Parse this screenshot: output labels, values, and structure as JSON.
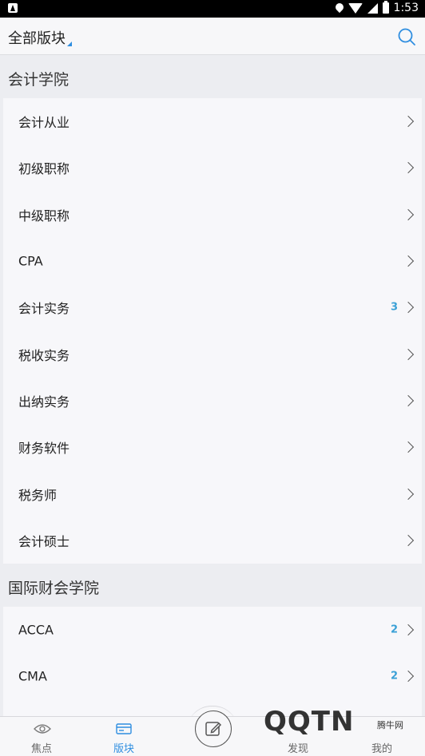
{
  "status_bar": {
    "time": "1:53"
  },
  "header": {
    "title": "全部版块"
  },
  "sections": [
    {
      "title": "会计学院",
      "items": [
        {
          "label": "会计从业",
          "badge": ""
        },
        {
          "label": "初级职称",
          "badge": ""
        },
        {
          "label": "中级职称",
          "badge": ""
        },
        {
          "label": "CPA",
          "badge": ""
        },
        {
          "label": "会计实务",
          "badge": "3"
        },
        {
          "label": "税收实务",
          "badge": ""
        },
        {
          "label": "出纳实务",
          "badge": ""
        },
        {
          "label": "财务软件",
          "badge": ""
        },
        {
          "label": "税务师",
          "badge": ""
        },
        {
          "label": "会计硕士",
          "badge": ""
        }
      ]
    },
    {
      "title": "国际财会学院",
      "items": [
        {
          "label": "ACCA",
          "badge": "2"
        },
        {
          "label": "CMA",
          "badge": "2"
        }
      ]
    }
  ],
  "tabbar": {
    "focus": "焦点",
    "board": "版块",
    "discover": "发现",
    "me": "我的"
  },
  "watermark": {
    "text": "QQTN",
    "small": "腾牛网"
  },
  "colors": {
    "accent": "#2f8ee0",
    "badge": "#3aa0d6"
  }
}
